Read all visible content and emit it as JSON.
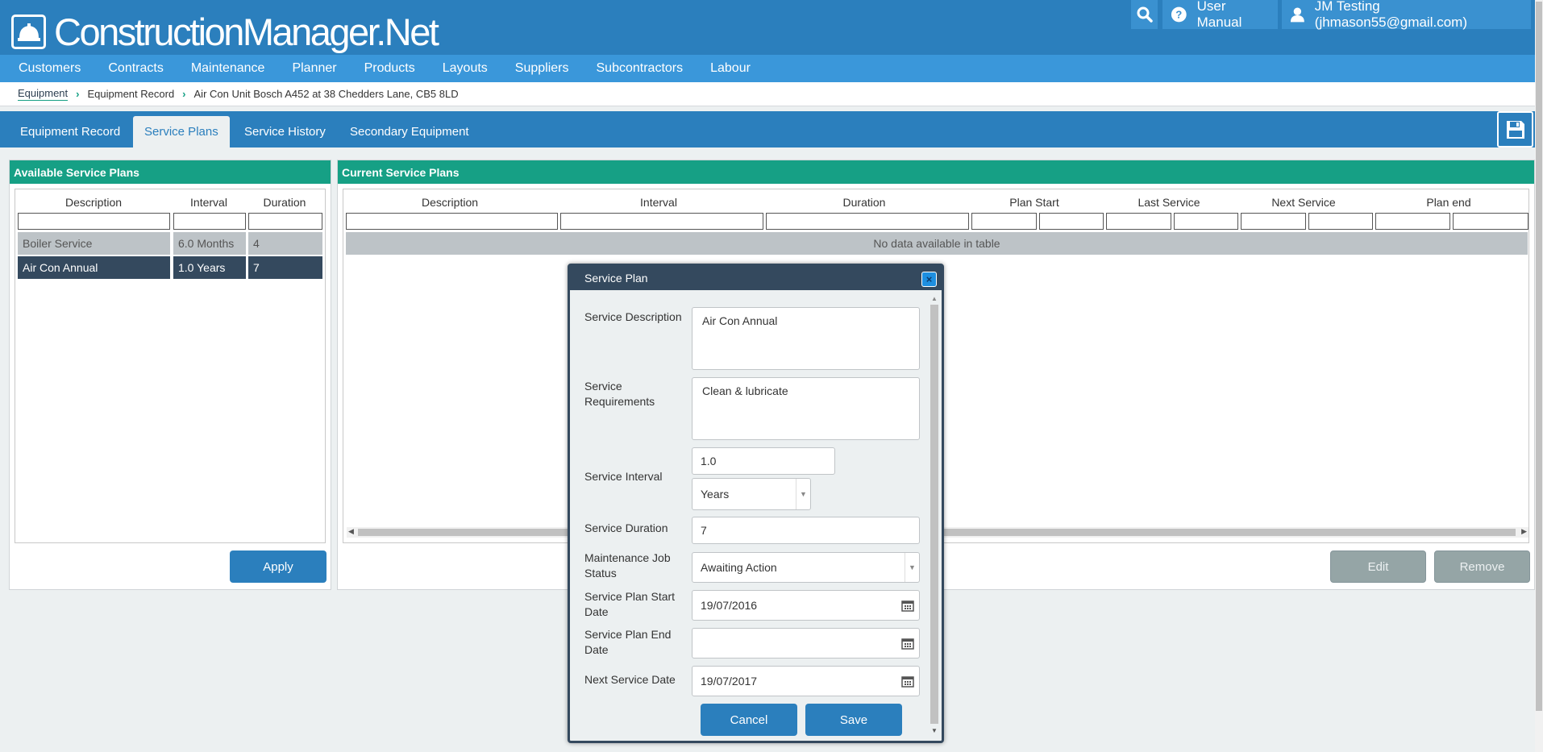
{
  "app": {
    "title": "ConstructionManager.Net"
  },
  "header": {
    "user_manual": "User Manual",
    "user": "JM Testing (jhmason55@gmail.com)"
  },
  "nav": [
    "Customers",
    "Contracts",
    "Maintenance",
    "Planner",
    "Products",
    "Layouts",
    "Suppliers",
    "Subcontractors",
    "Labour"
  ],
  "breadcrumb": [
    "Equipment",
    "Equipment Record",
    "Air Con Unit Bosch A452 at 38 Chedders Lane, CB5 8LD"
  ],
  "tabs": [
    "Equipment Record",
    "Service Plans",
    "Service History",
    "Secondary Equipment"
  ],
  "available": {
    "title": "Available Service Plans",
    "columns": [
      "Description",
      "Interval",
      "Duration"
    ],
    "rows": [
      {
        "description": "Boiler Service",
        "interval": "6.0 Months",
        "duration": "4"
      },
      {
        "description": "Air Con Annual",
        "interval": "1.0 Years",
        "duration": "7"
      }
    ],
    "apply": "Apply"
  },
  "current": {
    "title": "Current Service Plans",
    "columns": [
      "Description",
      "Interval",
      "Duration",
      "Plan Start",
      "Last Service",
      "Next Service",
      "Plan end"
    ],
    "empty": "No data available in table",
    "edit": "Edit",
    "remove": "Remove"
  },
  "modal": {
    "title": "Service Plan",
    "close": "×",
    "labels": {
      "description": "Service Description",
      "requirements": "Service Requirements",
      "interval": "Service Interval",
      "duration": "Service Duration",
      "job_status": "Maintenance Job Status",
      "start": "Service Plan Start Date",
      "end": "Service Plan End Date",
      "next": "Next Service Date"
    },
    "values": {
      "description": "Air Con Annual",
      "requirements": "Clean & lubricate",
      "interval": "1.0",
      "interval_unit": "Years",
      "duration": "7",
      "job_status": "Awaiting Action",
      "start": "19/07/2016",
      "end": "",
      "next": "19/07/2017"
    },
    "cancel": "Cancel",
    "save": "Save"
  }
}
